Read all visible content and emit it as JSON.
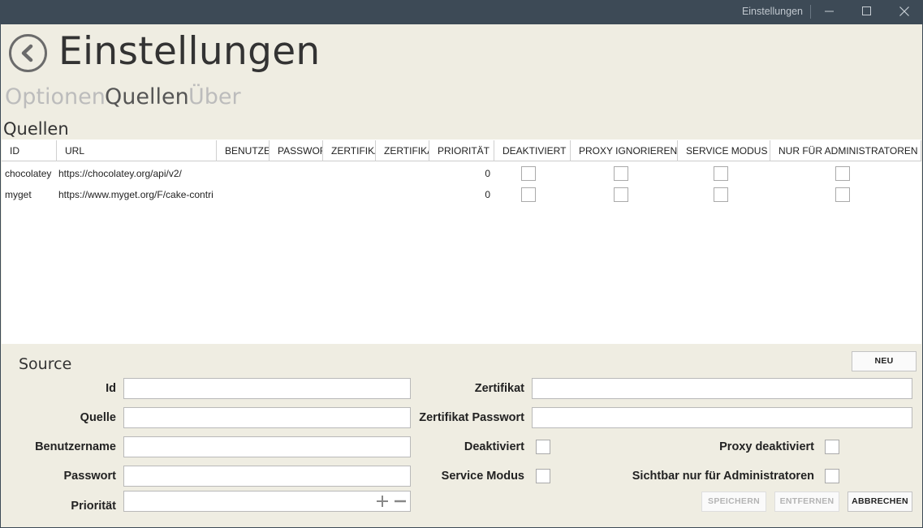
{
  "window": {
    "title": "Einstellungen"
  },
  "page": {
    "title": "Einstellungen"
  },
  "tabs": [
    "Optionen",
    "Quellen",
    "Über"
  ],
  "section": {
    "label": "Quellen"
  },
  "grid": {
    "columns": [
      "ID",
      "URL",
      "Benutzername",
      "Passwort",
      "Zertifikat",
      "Zertifikat Passwort",
      "Priorität",
      "Deaktiviert",
      "Proxy ignorieren",
      "Service Modus",
      "Nur für Administratoren"
    ],
    "rows": [
      {
        "id": "chocolatey",
        "url": "https://chocolatey.org/api/v2/",
        "priority": "0"
      },
      {
        "id": "myget",
        "url": "https://www.myget.org/F/cake-contrib",
        "priority": "0"
      }
    ]
  },
  "form": {
    "title": "Source",
    "new_label": "NEU",
    "id_label": "Id",
    "source_label": "Quelle",
    "username_label": "Benutzername",
    "password_label": "Passwort",
    "priority_label": "Priorität",
    "certificate_label": "Zertifikat",
    "certificate_password_label": "Zertifikat Passwort",
    "disabled_label": "Deaktiviert",
    "service_mode_label": "Service Modus",
    "proxy_disabled_label": "Proxy deaktiviert",
    "admin_only_label": "Sichtbar nur für Administratoren",
    "save_label": "SPEICHERN",
    "remove_label": "ENTFERNEN",
    "cancel_label": "ABBRECHEN"
  },
  "icons": {
    "back": "back-arrow-icon",
    "minimize": "minimize-icon",
    "maximize": "maximize-icon",
    "close": "close-icon"
  }
}
